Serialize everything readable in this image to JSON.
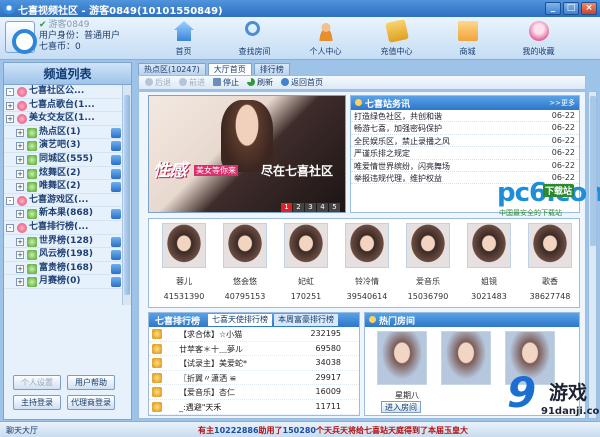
{
  "window": {
    "title": "七喜视频社区 - 游客0849(10101550849)",
    "buttons": [
      "_",
      "□",
      "×"
    ]
  },
  "user": {
    "nickname": "游客0849",
    "identity": "用户身份：普通用户",
    "coins": "七喜币：0"
  },
  "nav": [
    {
      "label": "首页",
      "icon": "home-icon"
    },
    {
      "label": "查找房间",
      "icon": "search-icon"
    },
    {
      "label": "个人中心",
      "icon": "user-icon"
    },
    {
      "label": "充值中心",
      "icon": "recharge-icon"
    },
    {
      "label": "商城",
      "icon": "shop-icon"
    },
    {
      "label": "我的收藏",
      "icon": "favorites-icon"
    }
  ],
  "channels": {
    "title": "频道列表",
    "items": [
      {
        "label": "七喜社区公...",
        "expander": "-",
        "level": 0
      },
      {
        "label": "七喜点歌台(1...",
        "expander": "+",
        "level": 1
      },
      {
        "label": "美女交友区(1...",
        "expander": "+",
        "level": 1
      },
      {
        "label": "热点区(1)",
        "expander": "+",
        "level": 2
      },
      {
        "label": "演艺吧(3)",
        "expander": "+",
        "level": 2
      },
      {
        "label": "同城区(555)",
        "expander": "+",
        "level": 2
      },
      {
        "label": "炫舞区(2)",
        "expander": "+",
        "level": 2
      },
      {
        "label": "唯舞区(2)",
        "expander": "+",
        "level": 2
      },
      {
        "label": "七喜游戏区(...",
        "expander": "-",
        "level": 0
      },
      {
        "label": "新本果(868)",
        "expander": "+",
        "level": 2
      },
      {
        "label": "七喜排行榜(...",
        "expander": "-",
        "level": 0
      },
      {
        "label": "世界榜(128)",
        "expander": "+",
        "level": 2
      },
      {
        "label": "风云榜(198)",
        "expander": "+",
        "level": 2
      },
      {
        "label": "富贵榜(168)",
        "expander": "+",
        "level": 2
      },
      {
        "label": "月赛榜(0)",
        "expander": "+",
        "level": 2
      }
    ],
    "buttons": {
      "settings": "个人设置",
      "help": "用户帮助",
      "host_login": "主持登录",
      "agent_login": "代理商登录"
    }
  },
  "tabs": [
    {
      "label": "热点区(10247)",
      "active": false
    },
    {
      "label": "大厅首页",
      "active": true
    },
    {
      "label": "排行榜",
      "active": false
    }
  ],
  "toolbar": {
    "back": "后退",
    "forward": "前进",
    "stop": "停止",
    "refresh": "刷新",
    "home": "返回首页"
  },
  "banner": {
    "slogan1": "性感",
    "slogan2": "美女等你来",
    "slogan3": "尽在七喜社区",
    "pages": [
      "1",
      "2",
      "3",
      "4",
      "5"
    ],
    "active_page": 1
  },
  "news": {
    "title": "七喜站务讯",
    "more": ">>更多",
    "items": [
      {
        "text": "打造绿色社区，共创和谐",
        "date": "06-22"
      },
      {
        "text": "畅游七喜，加强密码保护",
        "date": "06-22"
      },
      {
        "text": "全民娱乐区，禁止录播之风",
        "date": "06-22"
      },
      {
        "text": "严谨乐排之规定",
        "date": "06-22"
      },
      {
        "text": "唯爱情世界缤纷，闪亮舞场",
        "date": "06-22"
      },
      {
        "text": "举报违规代理，维护权益",
        "date": "06-22"
      }
    ]
  },
  "watermark": {
    "brand": "pc6",
    "suffix": ".com",
    "badge": "下载站",
    "sub": "中国最安全的下载站"
  },
  "hosts": [
    {
      "name": "蓉儿",
      "value": "41531390"
    },
    {
      "name": "悠会悠",
      "value": "40795153"
    },
    {
      "name": "妃虹",
      "value": "170251"
    },
    {
      "name": "铃冷情",
      "value": "39540614"
    },
    {
      "name": "爱音乐",
      "value": "15036790"
    },
    {
      "name": "姐镜",
      "value": "3021483"
    },
    {
      "name": "歌香",
      "value": "38627748"
    }
  ],
  "ranking": {
    "title": "七喜排行榜",
    "tabs": [
      "七喜天使排行榜",
      "本周富豪排行榜"
    ],
    "rows": [
      {
        "name": "【求合体】☆小猫",
        "value": "232195"
      },
      {
        "name": "廿苹客＊十＿夢ル",
        "value": "69580"
      },
      {
        "name": "【试录主】美爱蛇*",
        "value": "34038"
      },
      {
        "name": "〖折翼〃潇洒 ≌",
        "value": "29917"
      },
      {
        "name": "【爱音乐】杏仁",
        "value": "16009"
      },
      {
        "name": "_:遇避\"天禾",
        "value": "11711"
      }
    ]
  },
  "rooms": {
    "title": "热门房间",
    "first_room": "星期八",
    "enter": "进入房间"
  },
  "logo": {
    "num": "9",
    "text": "游戏",
    "url": "91danji.com"
  },
  "status": {
    "hall": "聊天大厅",
    "ticker_prefix": "有主",
    "ticker_id": "10",
    "ticker_a": "222886",
    "ticker_mid": "助用了",
    "ticker_b": "150280",
    "ticker_gift": "个天兵天将",
    "ticker_tail": "给七喜站天庭得到了本届",
    "ticker_end": "玉皇大"
  }
}
